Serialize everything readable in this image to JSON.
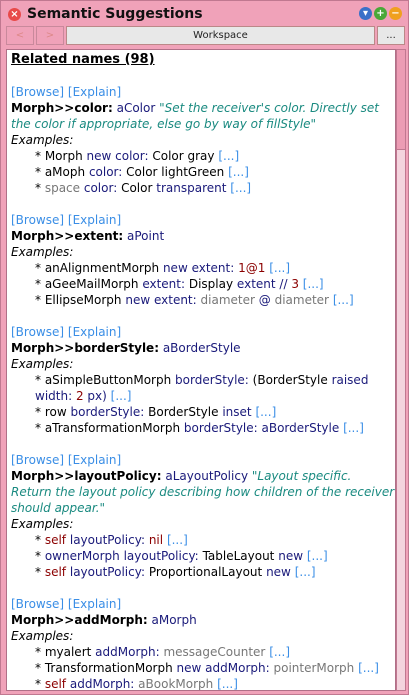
{
  "window": {
    "title": "Semantic Suggestions"
  },
  "toolbar": {
    "back": "<",
    "forward": ">",
    "workspace": "Workspace",
    "more": "..."
  },
  "header": "Related names (98)",
  "links": {
    "browse": "[Browse]",
    "explain": "[Explain]",
    "more": "[...]"
  },
  "examples_label": "Examples:",
  "sections": [
    {
      "sig": "Morph>>color:",
      "arg": "aColor",
      "comment": "\"Set the receiver's color.  Directly set the color if appropriate, else go by way of fillStyle\"",
      "examples": [
        [
          [
            "Morph",
            "k"
          ],
          [
            "new color:",
            "m"
          ],
          [
            "Color gray",
            "k"
          ]
        ],
        [
          [
            "aMoph",
            "k"
          ],
          [
            "color:",
            "m"
          ],
          [
            "Color lightGreen",
            "k"
          ]
        ],
        [
          [
            "space",
            "g"
          ],
          [
            "color:",
            "m"
          ],
          [
            "Color",
            "k"
          ],
          [
            "transparent",
            "m"
          ]
        ]
      ]
    },
    {
      "sig": "Morph>>extent:",
      "arg": "aPoint",
      "comment": "",
      "examples": [
        [
          [
            "anAlignmentMorph",
            "k"
          ],
          [
            "new extent:",
            "m"
          ],
          [
            "1@1",
            "r"
          ]
        ],
        [
          [
            "aGeeMailMorph",
            "k"
          ],
          [
            "extent:",
            "m"
          ],
          [
            "Display",
            "k"
          ],
          [
            "extent //",
            "m"
          ],
          [
            "3",
            "r"
          ]
        ],
        [
          [
            "EllipseMorph",
            "k"
          ],
          [
            "new extent:",
            "m"
          ],
          [
            "diameter",
            "g"
          ],
          [
            "@",
            "m"
          ],
          [
            "diameter",
            "g"
          ]
        ]
      ]
    },
    {
      "sig": "Morph>>borderStyle:",
      "arg": "aBorderStyle",
      "comment": "",
      "examples": [
        [
          [
            "aSimpleButtonMorph",
            "k"
          ],
          [
            "borderStyle:",
            "m"
          ],
          [
            "(BorderStyle",
            "k"
          ],
          [
            "raised width:",
            "m"
          ],
          [
            "2",
            "r"
          ],
          [
            "px)",
            "m"
          ]
        ],
        [
          [
            "row",
            "k"
          ],
          [
            "borderStyle:",
            "m"
          ],
          [
            "BorderStyle",
            "k"
          ],
          [
            "inset",
            "m"
          ]
        ],
        [
          [
            "aTransformationMorph",
            "k"
          ],
          [
            "borderStyle: aBorderStyle",
            "m"
          ]
        ]
      ]
    },
    {
      "sig": "Morph>>layoutPolicy:",
      "arg": "aLayoutPolicy",
      "comment": "\"Layout specific. Return the layout policy describing how children of the receiver should appear.\"",
      "examples": [
        [
          [
            "self",
            "r"
          ],
          [
            "layoutPolicy:",
            "m"
          ],
          [
            "nil",
            "r"
          ]
        ],
        [
          [
            "ownerMorph",
            "m"
          ],
          [
            "layoutPolicy:",
            "m"
          ],
          [
            "TableLayout",
            "k"
          ],
          [
            "new",
            "m"
          ]
        ],
        [
          [
            "self",
            "r"
          ],
          [
            "layoutPolicy:",
            "m"
          ],
          [
            "ProportionalLayout",
            "k"
          ],
          [
            "new",
            "m"
          ]
        ]
      ]
    },
    {
      "sig": "Morph>>addMorph:",
      "arg": "aMorph",
      "comment": "",
      "examples": [
        [
          [
            "myalert",
            "k"
          ],
          [
            "addMorph:",
            "m"
          ],
          [
            "messageCounter",
            "g"
          ]
        ],
        [
          [
            "TransformationMorph",
            "k"
          ],
          [
            "new addMorph:",
            "m"
          ],
          [
            "pointerMorph",
            "g"
          ]
        ],
        [
          [
            "self",
            "r"
          ],
          [
            "addMorph:",
            "m"
          ],
          [
            "aBookMorph",
            "g"
          ]
        ]
      ]
    }
  ]
}
